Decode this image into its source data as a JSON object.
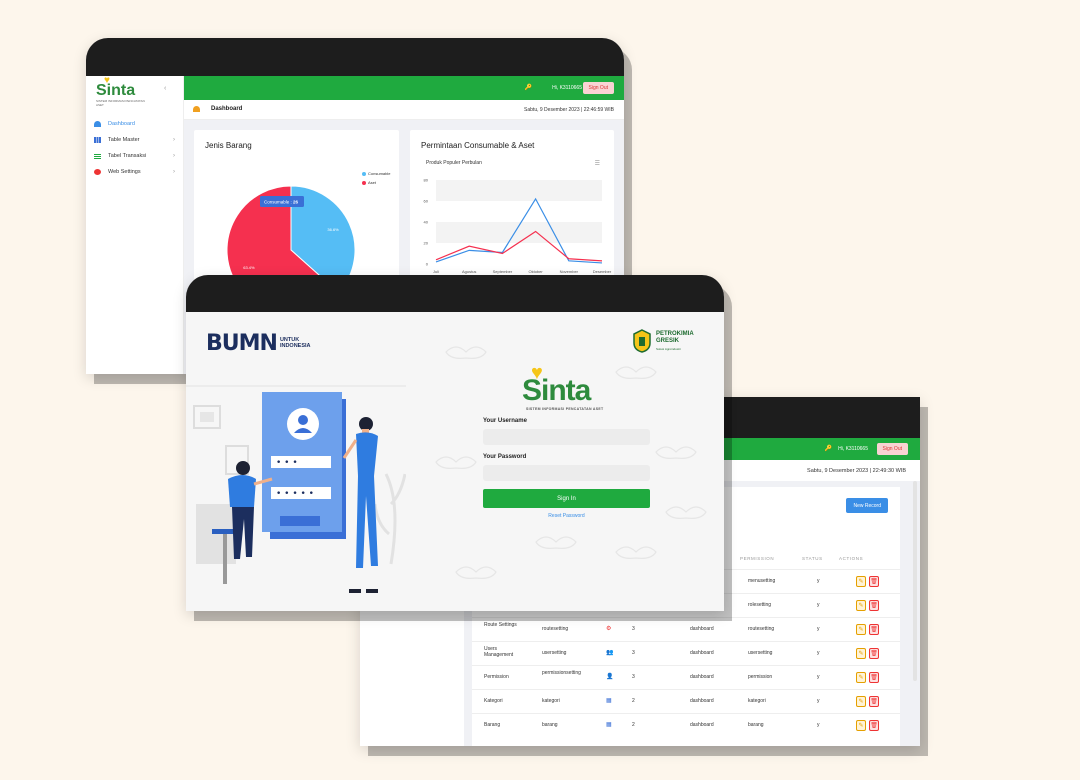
{
  "dashboard": {
    "logo": "Sinta",
    "logo_subtitle": "SISTEM INFORMASI PENCATATAN ASET",
    "nav": [
      {
        "label": "Dashboard",
        "active": true
      },
      {
        "label": "Table Master"
      },
      {
        "label": "Tabel Transaksi"
      },
      {
        "label": "Web Settings"
      }
    ],
    "user": "Hi, K3110665",
    "sign_out": "Sign Out",
    "page_title": "Dashboard",
    "datetime": "Sabtu, 9 Desember 2023 | 22:46:59 WIB",
    "card_pie_title": "Jenis Barang",
    "card_line_title": "Permintaan Consumable & Aset",
    "line_subtitle": "Produk Populer Perbulan",
    "tooltip_label": "Consumable :",
    "tooltip_value": "26",
    "colors": {
      "green": "#1faa3f",
      "blue": "#55bdf5",
      "red": "#f5304f"
    }
  },
  "chart_data": [
    {
      "type": "pie",
      "title": "Jenis Barang",
      "labels": [
        "Consumable",
        "Aset"
      ],
      "values": [
        26,
        45
      ],
      "slice_labels": [
        "36.6%",
        "63.4%"
      ],
      "legend_position": "top-right"
    },
    {
      "type": "line",
      "title": "Produk Populer Perbulan",
      "categories": [
        "Juli",
        "Agustus",
        "September",
        "Oktober",
        "November",
        "Desember"
      ],
      "series": [
        {
          "name": "",
          "values": [
            2,
            13,
            11,
            62,
            3,
            1
          ],
          "color": "#3a8ee6"
        },
        {
          "name": "",
          "values": [
            4,
            17,
            10,
            31,
            5,
            3
          ],
          "color": "#f5304f"
        }
      ],
      "yticks": [
        "0",
        "20",
        "40",
        "60",
        "80"
      ],
      "ylim": [
        0,
        80
      ],
      "grid": true
    }
  ],
  "login": {
    "bumn_big": "BUMN",
    "bumn_small_1": "UNTUK",
    "bumn_small_2": "INDONESIA",
    "pg_name_1": "PETROKIMIA",
    "pg_name_2": "GRESIK",
    "pg_sub": "Solusi Agroindustri",
    "app_name": "Sinta",
    "app_subtitle": "SISTEM INFORMASI PENCATATAN ASET",
    "username_label": "Your Username",
    "password_label": "Your Password",
    "username_value": "",
    "password_value": "",
    "signin_label": "Sign In",
    "reset_label": "Reset Password"
  },
  "table_window": {
    "user": "Hi, K3110665",
    "sign_out": "Sign Out",
    "datetime": "Sabtu, 9 Desember 2023 | 22:49:30 WIB",
    "new_record": "New Record",
    "headers": {
      "permission": "PERMISSION",
      "status": "STATUS",
      "actions": "ACTIONS"
    },
    "rows": [
      {
        "name": "",
        "route": "",
        "icon": "",
        "order": "",
        "parent": "",
        "permission": "menusetting",
        "status": "y"
      },
      {
        "name": "",
        "route": "",
        "icon": "",
        "order": "",
        "parent": "",
        "permission": "rolesetting",
        "status": "y"
      },
      {
        "name": "Route Settings",
        "route": "routesetting",
        "icon": "⚙",
        "order": "3",
        "parent": "dashboard",
        "permission": "routesetting",
        "status": "y"
      },
      {
        "name": "Users Management",
        "route": "usersetting",
        "icon": "👥",
        "order": "3",
        "parent": "dashboard",
        "permission": "usersetting",
        "status": "y"
      },
      {
        "name": "Permission",
        "route": "permissionsetting",
        "icon": "👤",
        "order": "3",
        "parent": "dashboard",
        "permission": "permission",
        "status": "y"
      },
      {
        "name": "Kategori",
        "route": "kategori",
        "icon": "▦",
        "order": "2",
        "parent": "dashboard",
        "permission": "kategori",
        "status": "y"
      },
      {
        "name": "Barang",
        "route": "barang",
        "icon": "▦",
        "order": "2",
        "parent": "dashboard",
        "permission": "barang",
        "status": "y"
      }
    ]
  }
}
